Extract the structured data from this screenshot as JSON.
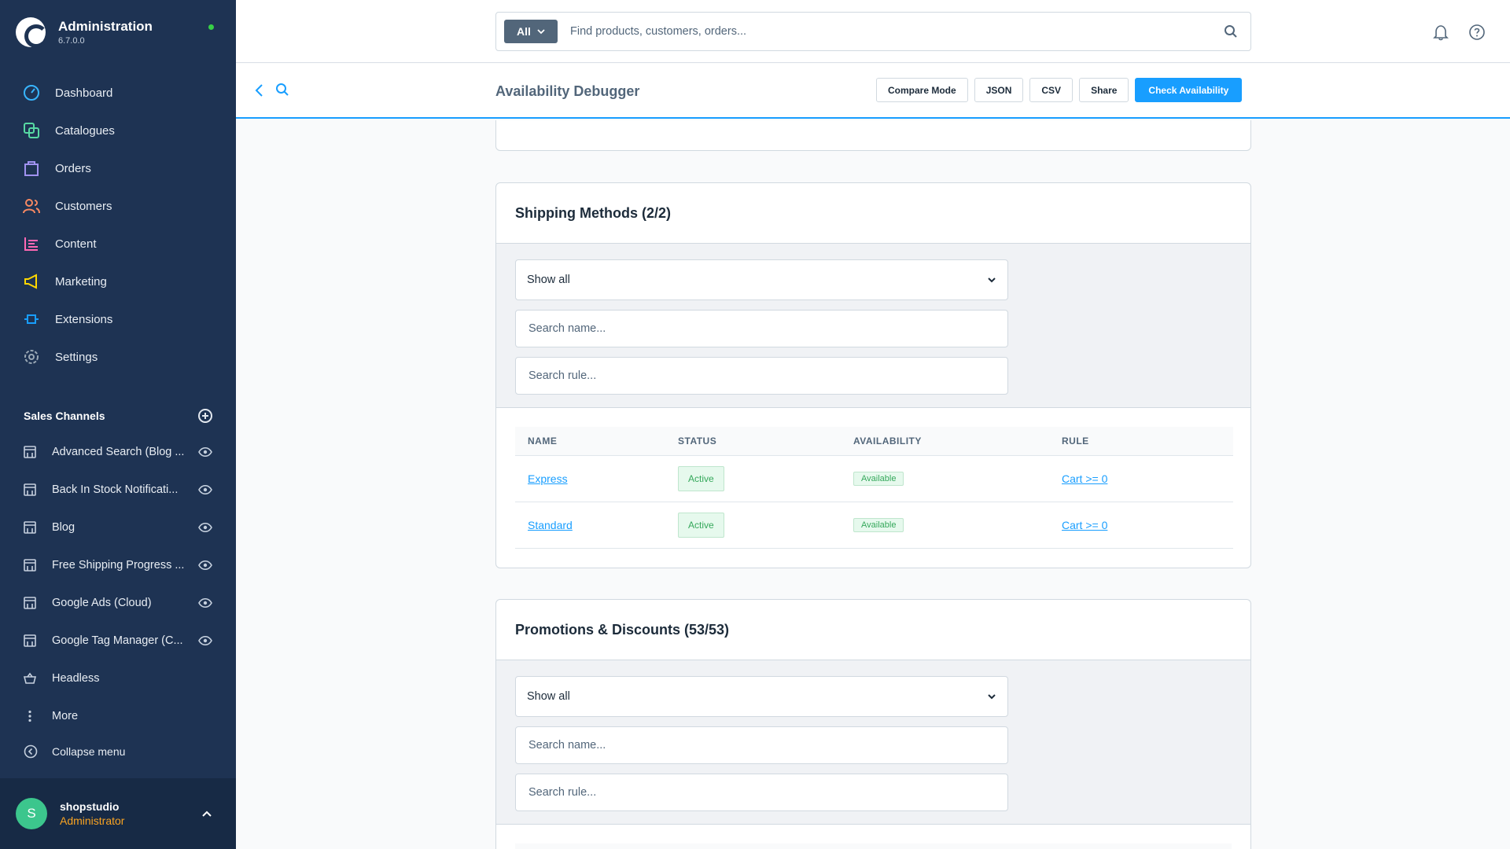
{
  "app": {
    "title": "Administration",
    "version": "6.7.0.0"
  },
  "nav": [
    {
      "label": "Dashboard",
      "icon": "dashboard-icon",
      "color": "#38b5ff"
    },
    {
      "label": "Catalogues",
      "icon": "catalogue-icon",
      "color": "#57d9a3"
    },
    {
      "label": "Orders",
      "icon": "orders-icon",
      "color": "#a092f0"
    },
    {
      "label": "Customers",
      "icon": "customers-icon",
      "color": "#f88962"
    },
    {
      "label": "Content",
      "icon": "content-icon",
      "color": "#ff68b4"
    },
    {
      "label": "Marketing",
      "icon": "marketing-icon",
      "color": "#ffd700"
    },
    {
      "label": "Extensions",
      "icon": "extensions-icon",
      "color": "#189eff"
    },
    {
      "label": "Settings",
      "icon": "settings-icon",
      "color": "#9aa8b5"
    }
  ],
  "sales_channels": {
    "title": "Sales Channels",
    "items": [
      {
        "label": "Advanced Search (Blog ..."
      },
      {
        "label": "Back In Stock Notificati..."
      },
      {
        "label": "Blog"
      },
      {
        "label": "Free Shipping Progress ..."
      },
      {
        "label": "Google Ads (Cloud)"
      },
      {
        "label": "Google Tag Manager (C..."
      },
      {
        "label": "Headless"
      },
      {
        "label": "More"
      }
    ]
  },
  "collapse_label": "Collapse menu",
  "user": {
    "initial": "S",
    "name": "shopstudio",
    "role": "Administrator"
  },
  "search": {
    "type": "All",
    "placeholder": "Find products, customers, orders..."
  },
  "smartbar": {
    "title": "Availability Debugger",
    "buttons": {
      "compare": "Compare Mode",
      "json": "JSON",
      "csv": "CSV",
      "share": "Share",
      "check": "Check Availability"
    }
  },
  "shipping": {
    "title": "Shipping Methods (2/2)",
    "filter_value": "Show all",
    "search_name_placeholder": "Search name...",
    "search_rule_placeholder": "Search rule...",
    "columns": [
      "NAME",
      "STATUS",
      "AVAILABILITY",
      "RULE"
    ],
    "rows": [
      {
        "name": "Express",
        "status": "Active",
        "availability": "Available",
        "rule": "Cart >= 0"
      },
      {
        "name": "Standard",
        "status": "Active",
        "availability": "Available",
        "rule": "Cart >= 0"
      }
    ]
  },
  "promotions": {
    "title": "Promotions & Discounts (53/53)",
    "filter_value": "Show all",
    "search_name_placeholder": "Search name...",
    "search_rule_placeholder": "Search rule..."
  },
  "colors": {
    "sidebar": "#1e3353",
    "primary": "#189eff",
    "success": "#35a85b"
  }
}
